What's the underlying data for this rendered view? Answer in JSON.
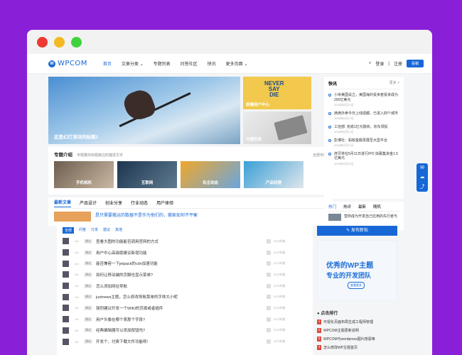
{
  "header": {
    "logo": "WPCOM",
    "nav": [
      "首页",
      "文章分类 ⌄",
      "专题列表",
      "问答社区",
      "快讯",
      "更多页面 ⌄"
    ],
    "login": "登录",
    "register": "注册",
    "contribute": "投稿"
  },
  "hero": {
    "main_caption": "这是幻灯滑块的标题1",
    "tile1_text": "NEVER\nSAY\nDIE",
    "tile1_caption": "前端用户中心",
    "tile2_caption": "专题列表"
  },
  "topics": {
    "title": "专题介绍",
    "subtitle": "专题模块标题旁边的描述文字",
    "more": "全部专题",
    "items": [
      "手机相机",
      "互联网",
      "名企动态",
      "产品经理"
    ]
  },
  "tabs": {
    "items": [
      "最新文章",
      "产品设计",
      "创业分享",
      "行业动态",
      "用户体验"
    ],
    "peek": "是只需要搬运的数据不是作为他们的，搬家如何不平衡"
  },
  "flash": {
    "title": "快讯",
    "more": "更多 >",
    "items": [
      {
        "text": "小米美国设立，美国海外投资者投资成为200亿美元",
        "date": "2018年6月21日"
      },
      {
        "text": "滴滴外卖今日上线成都、已进入四个城市",
        "date": "2018年6月21日"
      },
      {
        "text": "工信部: 完成1亿元融资，京东领投",
        "date": "2018年6月21日"
      },
      {
        "text": "彭博社：蚂蚁金服发展至大型平台",
        "date": "2018年6月21日"
      },
      {
        "text": "虎牙将在5月11日进行IPO 拟募集资金1.5亿美元",
        "date": "2018年6月21日"
      }
    ]
  },
  "hot": {
    "tabs": [
      "热门",
      "热评",
      "最新",
      "随机"
    ],
    "item": "营商成为开发自己应用的先行者与"
  },
  "qa": {
    "tabs": [
      "全部",
      "问答",
      "分享",
      "建议",
      "其他"
    ],
    "rows": [
      {
        "title": "查看大图的功能能否调用官网的方式"
      },
      {
        "title": "用户中心高级版建议新增功能"
      },
      {
        "title": "能否兼容一下jetpack的cdn加速功能"
      },
      {
        "title": "如何让移动端的页脚也显示菜单?"
      },
      {
        "title": "怎么添加网址导航"
      },
      {
        "title": "justnews主题，怎么修改导航菜单的字体大小呢"
      },
      {
        "title": "强烈建议开发一个WIKI的页面或者插件"
      },
      {
        "title": "用户头像在哪个表那个字段?"
      },
      {
        "title": "经典编辑器可以添加按钮吗?"
      },
      {
        "title": "开发个，付费下载文件功能呗!"
      }
    ],
    "time": "1m",
    "tag": "建议",
    "stat": "22小时前"
  },
  "right": {
    "post_button": "✎ 发布新帖",
    "ad_line1": "优秀的WP主题",
    "ad_line2": "专业的开发团队",
    "ad_button": "查看更多",
    "rank_title": "● 点击排行",
    "ranks": [
      "可视化页面布局生成工程师管理",
      "WPCOM主题更新说明",
      "WPCOM与wordpress图片按需等",
      "怎么修改WP主题首页"
    ]
  }
}
